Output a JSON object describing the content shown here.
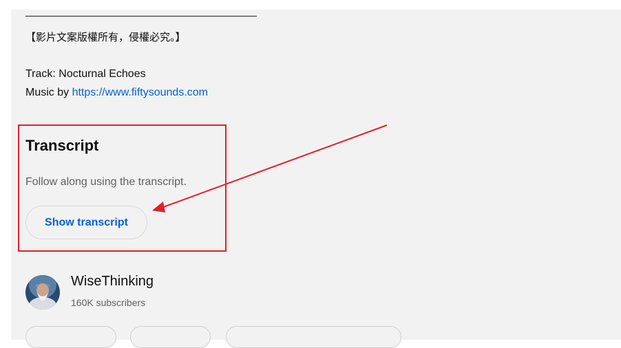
{
  "description": {
    "divider": "————————————————————————",
    "copyright": "【影片文案版權所有，侵權必究。】",
    "track_line": "Track: Nocturnal Echoes",
    "music_prefix": "Music by ",
    "music_link": "https://www.fiftysounds.com"
  },
  "transcript": {
    "title": "Transcript",
    "description": "Follow along using the transcript.",
    "button_label": "Show transcript"
  },
  "channel": {
    "name": "WiseThinking",
    "subscribers": "160K subscribers"
  },
  "annotation": {
    "color": "#e0202a"
  },
  "colors": {
    "link": "#065fd4",
    "panel_bg": "#f2f2f2",
    "secondary_text": "#606060"
  }
}
